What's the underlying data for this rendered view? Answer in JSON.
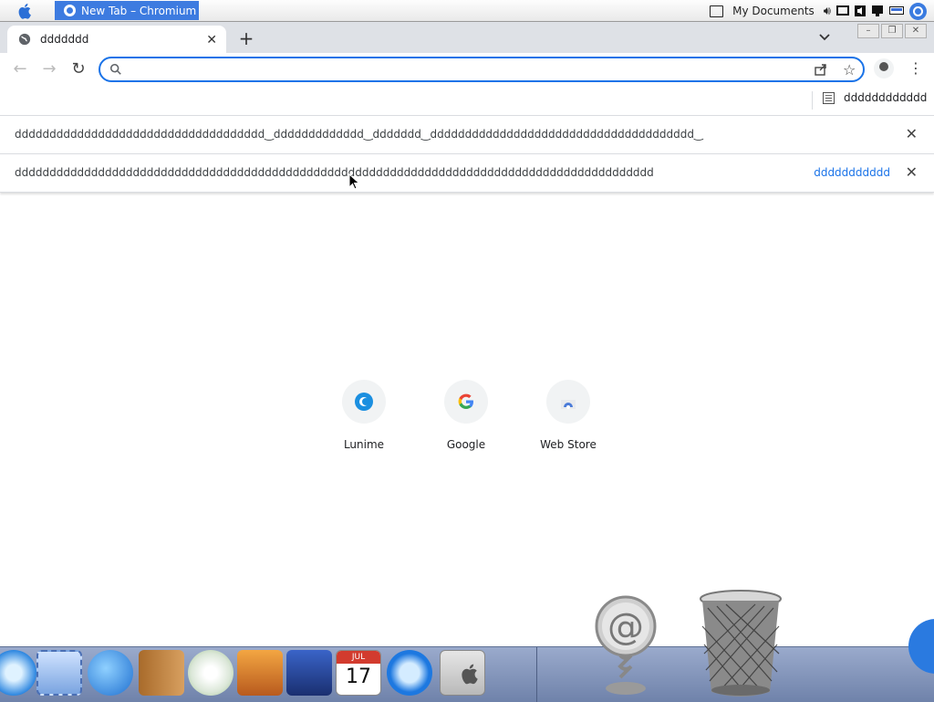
{
  "menubar": {
    "active_task": "New Tab – Chromium",
    "tray_label": "My Documents"
  },
  "tabs": [
    {
      "title": "ddddddd"
    }
  ],
  "omnibox": {
    "value": "",
    "placeholder": ""
  },
  "bookmarks": {
    "reading_list_label": "dddddddddddd"
  },
  "infobars": [
    {
      "message": "dddddddddddddddddddddddddddddddddddd‿ddddddddddddd‿ddddddd‿dddddddddddddddddddddddddddddddddddddd‿",
      "action": ""
    },
    {
      "message": "dddddddddddddddddddddddddddddddddddddddddddddddddddddddddddddddddddddddddddddddddddddddddddd",
      "action": "ddddddddddd"
    }
  ],
  "shortcuts": [
    {
      "label": "Lunime",
      "icon": "lunime-icon"
    },
    {
      "label": "Google",
      "icon": "google-icon"
    },
    {
      "label": "Web Store",
      "icon": "web-store-icon"
    }
  ],
  "dock": {
    "items": [
      "safari",
      "mail-stamp",
      "ichat",
      "address-book",
      "itunes",
      "iphoto",
      "imovie",
      "ical",
      "quicktime",
      "system-preferences",
      "mail-stand",
      "trash"
    ],
    "ical_month": "JUL",
    "ical_day": "17"
  },
  "colors": {
    "accent": "#1a73e8",
    "task_highlight": "#3d7be0",
    "dock": "#7f90b5"
  }
}
